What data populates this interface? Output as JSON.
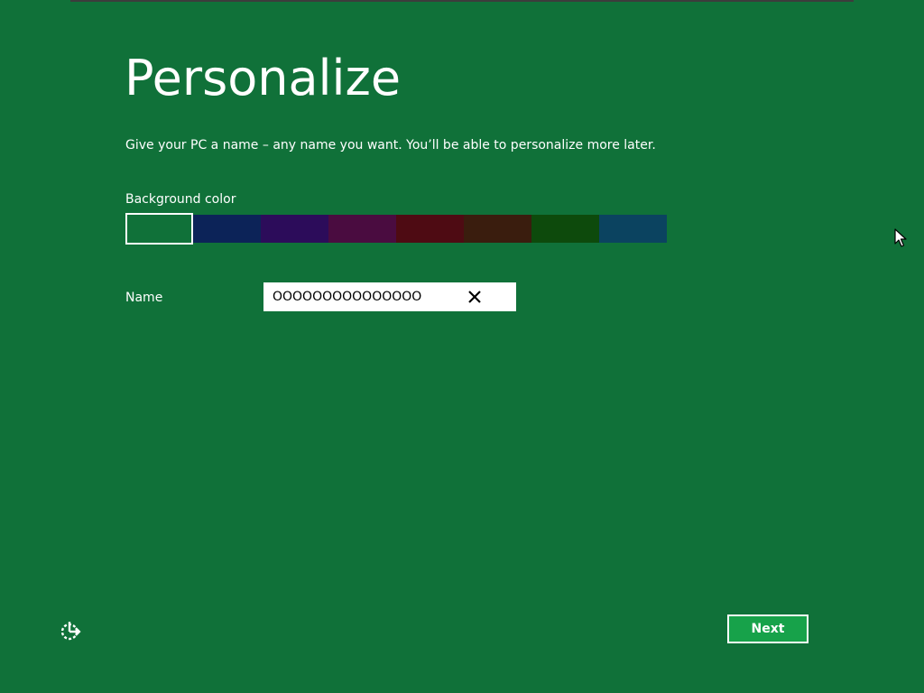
{
  "page": {
    "title": "Personalize",
    "subtitle": "Give your PC a name – any name you want. You’ll be able to personalize more later."
  },
  "background": {
    "label": "Background color",
    "selected_index": 0,
    "swatches": [
      "#107139",
      "#0c2358",
      "#2c0c5a",
      "#4a0c40",
      "#4e0b13",
      "#3a1d0e",
      "#0d4a0c",
      "#0b4360"
    ]
  },
  "name": {
    "label": "Name",
    "value": "OOOOOOOOOOOOOOO"
  },
  "footer": {
    "next_label": "Next"
  },
  "icons": {
    "clear": "close-icon",
    "ease_of_access": "ease-of-access-icon",
    "pointer": "mouse-pointer-icon"
  },
  "colors": {
    "background": "#107139",
    "next_button": "#17a24a"
  }
}
